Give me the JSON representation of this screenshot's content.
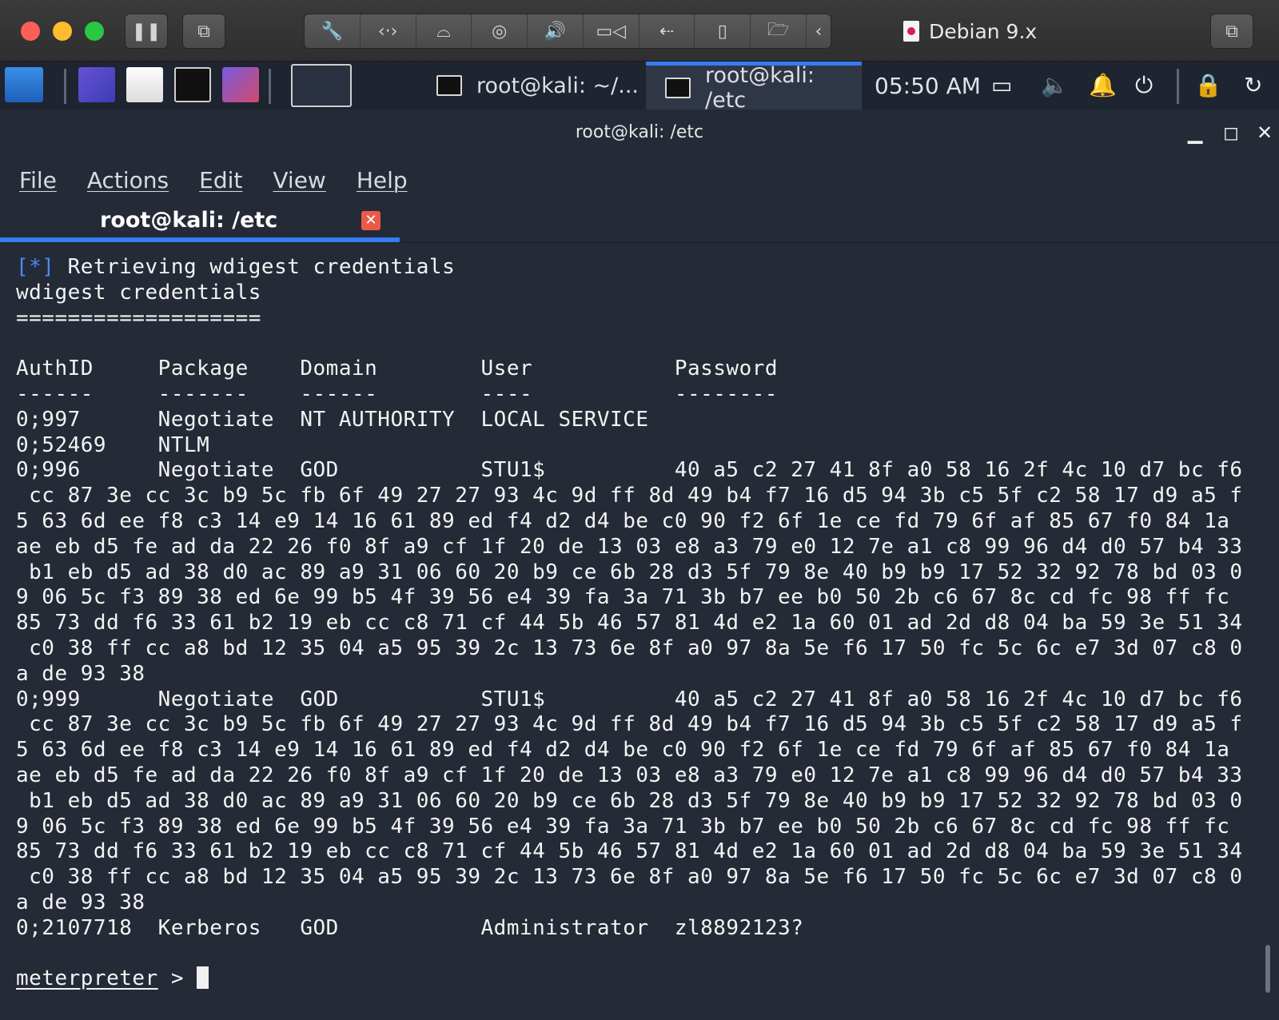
{
  "vm_window": {
    "title": "Debian 9.x",
    "toolbar_icons": [
      "pause-icon",
      "snapshot-icon",
      "wrench-icon",
      "network-icon",
      "harddisk-icon",
      "camera-icon",
      "sound-icon",
      "video-icon",
      "usb-icon",
      "mouse-icon",
      "shared-folder-icon",
      "chevron-left-icon",
      "restore-icon"
    ]
  },
  "taskbar": {
    "tasks": [
      {
        "label": "root@kali: ~/..."
      },
      {
        "label": "root@kali: /etc"
      }
    ],
    "clock": "05:50 AM",
    "tray_icons": [
      "display-icon",
      "volume-icon",
      "bell-icon",
      "power-icon",
      "lock-icon",
      "logout-icon"
    ]
  },
  "terminal": {
    "window_title": "root@kali: /etc",
    "menu": [
      "File",
      "Actions",
      "Edit",
      "View",
      "Help"
    ],
    "tab_label": "root@kali: /etc",
    "lines": [
      {
        "prefix": "[*]",
        "text": " Retrieving wdigest credentials"
      },
      {
        "prefix": "",
        "text": "wdigest credentials"
      },
      {
        "prefix": "",
        "text": "==================="
      },
      {
        "prefix": "",
        "text": ""
      },
      {
        "prefix": "",
        "text": "AuthID     Package    Domain        User           Password"
      },
      {
        "prefix": "",
        "text": "------     -------    ------        ----           --------"
      },
      {
        "prefix": "",
        "text": "0;997      Negotiate  NT AUTHORITY  LOCAL SERVICE"
      },
      {
        "prefix": "",
        "text": "0;52469    NTLM"
      },
      {
        "prefix": "",
        "text": "0;996      Negotiate  GOD           STU1$          40 a5 c2 27 41 8f a0 58 16 2f 4c 10 d7 bc f6"
      },
      {
        "prefix": "",
        "text": " cc 87 3e cc 3c b9 5c fb 6f 49 27 27 93 4c 9d ff 8d 49 b4 f7 16 d5 94 3b c5 5f c2 58 17 d9 a5 f"
      },
      {
        "prefix": "",
        "text": "5 63 6d ee f8 c3 14 e9 14 16 61 89 ed f4 d2 d4 be c0 90 f2 6f 1e ce fd 79 6f af 85 67 f0 84 1a"
      },
      {
        "prefix": "",
        "text": "ae eb d5 fe ad da 22 26 f0 8f a9 cf 1f 20 de 13 03 e8 a3 79 e0 12 7e a1 c8 99 96 d4 d0 57 b4 33"
      },
      {
        "prefix": "",
        "text": " b1 eb d5 ad 38 d0 ac 89 a9 31 06 60 20 b9 ce 6b 28 d3 5f 79 8e 40 b9 b9 17 52 32 92 78 bd 03 0"
      },
      {
        "prefix": "",
        "text": "9 06 5c f3 89 38 ed 6e 99 b5 4f 39 56 e4 39 fa 3a 71 3b b7 ee b0 50 2b c6 67 8c cd fc 98 ff fc"
      },
      {
        "prefix": "",
        "text": "85 73 dd f6 33 61 b2 19 eb cc c8 71 cf 44 5b 46 57 81 4d e2 1a 60 01 ad 2d d8 04 ba 59 3e 51 34"
      },
      {
        "prefix": "",
        "text": " c0 38 ff cc a8 bd 12 35 04 a5 95 39 2c 13 73 6e 8f a0 97 8a 5e f6 17 50 fc 5c 6c e7 3d 07 c8 0"
      },
      {
        "prefix": "",
        "text": "a de 93 38"
      },
      {
        "prefix": "",
        "text": "0;999      Negotiate  GOD           STU1$          40 a5 c2 27 41 8f a0 58 16 2f 4c 10 d7 bc f6"
      },
      {
        "prefix": "",
        "text": " cc 87 3e cc 3c b9 5c fb 6f 49 27 27 93 4c 9d ff 8d 49 b4 f7 16 d5 94 3b c5 5f c2 58 17 d9 a5 f"
      },
      {
        "prefix": "",
        "text": "5 63 6d ee f8 c3 14 e9 14 16 61 89 ed f4 d2 d4 be c0 90 f2 6f 1e ce fd 79 6f af 85 67 f0 84 1a"
      },
      {
        "prefix": "",
        "text": "ae eb d5 fe ad da 22 26 f0 8f a9 cf 1f 20 de 13 03 e8 a3 79 e0 12 7e a1 c8 99 96 d4 d0 57 b4 33"
      },
      {
        "prefix": "",
        "text": " b1 eb d5 ad 38 d0 ac 89 a9 31 06 60 20 b9 ce 6b 28 d3 5f 79 8e 40 b9 b9 17 52 32 92 78 bd 03 0"
      },
      {
        "prefix": "",
        "text": "9 06 5c f3 89 38 ed 6e 99 b5 4f 39 56 e4 39 fa 3a 71 3b b7 ee b0 50 2b c6 67 8c cd fc 98 ff fc"
      },
      {
        "prefix": "",
        "text": "85 73 dd f6 33 61 b2 19 eb cc c8 71 cf 44 5b 46 57 81 4d e2 1a 60 01 ad 2d d8 04 ba 59 3e 51 34"
      },
      {
        "prefix": "",
        "text": " c0 38 ff cc a8 bd 12 35 04 a5 95 39 2c 13 73 6e 8f a0 97 8a 5e f6 17 50 fc 5c 6c e7 3d 07 c8 0"
      },
      {
        "prefix": "",
        "text": "a de 93 38"
      },
      {
        "prefix": "",
        "text": "0;2107718  Kerberos   GOD           Administrator  zl8892123?"
      },
      {
        "prefix": "",
        "text": ""
      }
    ],
    "prompt": "meterpreter",
    "prompt_suffix": " > "
  },
  "colors": {
    "accent": "#367bf0",
    "terminal_bg": "#242a36",
    "info_marker": "#4a8cf0"
  }
}
